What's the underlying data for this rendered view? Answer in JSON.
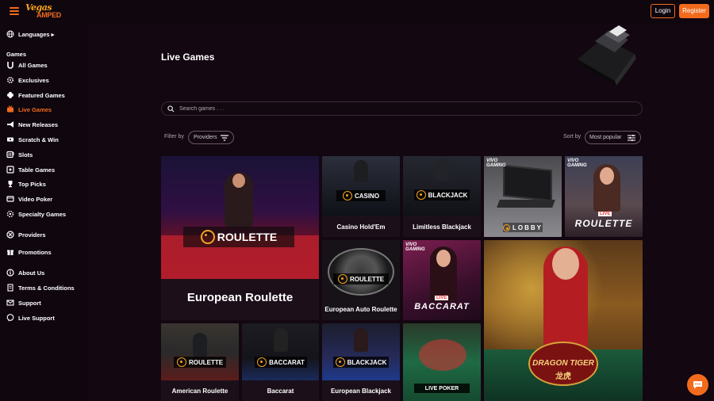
{
  "header": {
    "logo_line1": "Vegas",
    "logo_line2": "AMPED",
    "login_label": "Login",
    "register_label": "Register"
  },
  "sidebar": {
    "languages_label": "Languages ▸",
    "games_heading": "Games",
    "items": [
      {
        "label": "All Games",
        "icon": "horseshoe-icon"
      },
      {
        "label": "Exclusives",
        "icon": "gear-icon"
      },
      {
        "label": "Featured Games",
        "icon": "clover-icon"
      },
      {
        "label": "Live Games",
        "icon": "live-icon"
      },
      {
        "label": "New Releases",
        "icon": "megaphone-icon"
      },
      {
        "label": "Scratch & Win",
        "icon": "ticket-icon"
      },
      {
        "label": "Slots",
        "icon": "slot-icon"
      },
      {
        "label": "Table Games",
        "icon": "table-icon"
      },
      {
        "label": "Top Picks",
        "icon": "trophy-icon"
      },
      {
        "label": "Video Poker",
        "icon": "video-icon"
      },
      {
        "label": "Specialty Games",
        "icon": "specialty-icon"
      }
    ],
    "providers_label": "Providers",
    "promotions_label": "Promotions",
    "footer_items": [
      {
        "label": "About Us",
        "icon": "info-icon"
      },
      {
        "label": "Terms & Conditions",
        "icon": "document-icon"
      },
      {
        "label": "Support",
        "icon": "mail-icon"
      },
      {
        "label": "Live Support",
        "icon": "chat-icon"
      }
    ],
    "active_item": "Live Games"
  },
  "main": {
    "title": "Live Games",
    "search_placeholder": "Search games . . .",
    "filter_label": "Filter by",
    "filter_value": "Providers",
    "sort_label": "Sort by",
    "sort_value": "Most popular"
  },
  "games": {
    "european_roulette": {
      "title": "European Roulette",
      "badge": "ROULETTE"
    },
    "casino_holdem": {
      "title": "Casino Hold'Em",
      "badge": "CASINO"
    },
    "limitless_blackjack": {
      "title": "Limitless Blackjack",
      "badge": "BLACKJACK"
    },
    "vivo_lobby": {
      "brand": "VIVO GAMING",
      "badge": "LOBBY"
    },
    "vivo_roulette": {
      "brand": "VIVO GAMING",
      "live": "LIVE",
      "badge": "ROULETTE"
    },
    "european_auto_roulette": {
      "title": "European Auto Roulette",
      "badge": "ROULETTE"
    },
    "vivo_baccarat": {
      "brand": "VIVO GAMING",
      "live": "LIVE",
      "badge": "BACCARAT"
    },
    "dragon_tiger": {
      "badge": "DRAGON TIGER",
      "sub": "龙虎"
    },
    "american_roulette": {
      "title": "American Roulette",
      "badge": "ROULETTE"
    },
    "baccarat": {
      "title": "Baccarat",
      "badge": "BACCARAT"
    },
    "european_blackjack": {
      "title": "European Blackjack",
      "badge": "BLACKJACK"
    },
    "live_poker": {
      "badge": "LIVE POKER"
    }
  },
  "colors": {
    "accent": "#f26b1d",
    "background": "#130711",
    "sidebar": "#0f060e"
  }
}
